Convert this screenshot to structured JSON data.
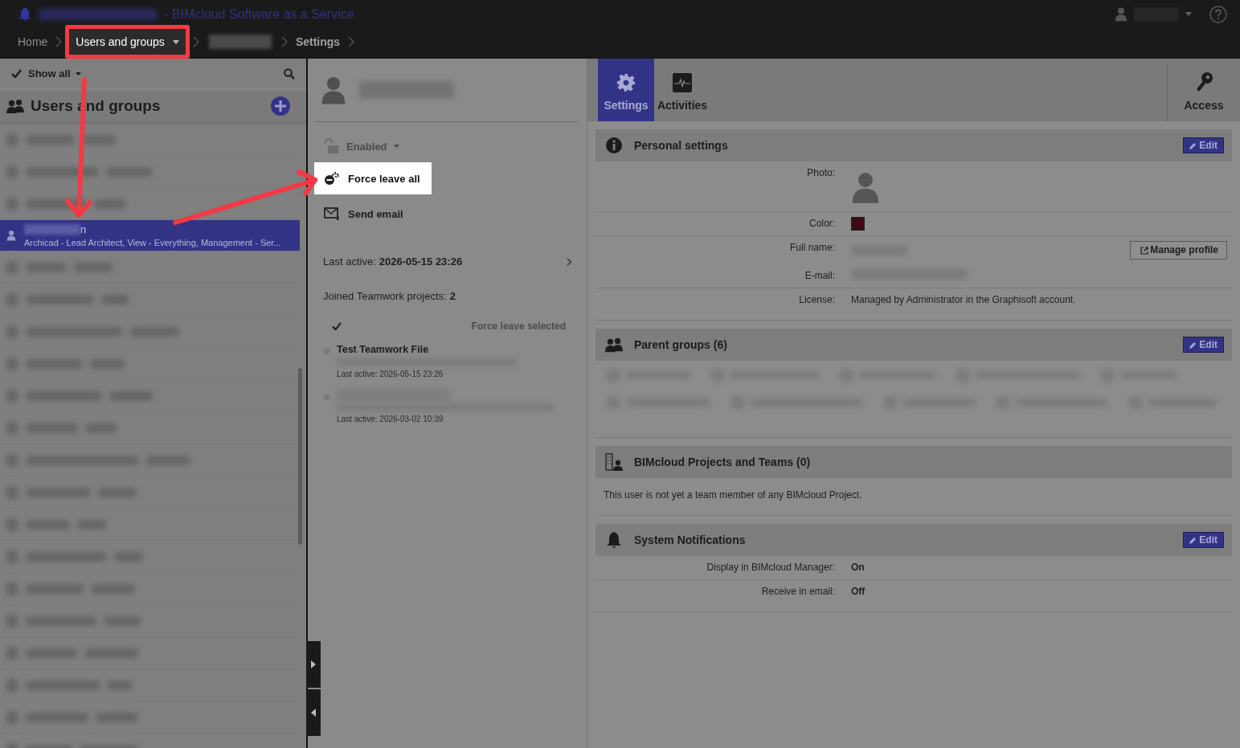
{
  "window": {
    "title": "- BIMcloud Software as a Service"
  },
  "breadcrumb": [
    {
      "kind": "link",
      "label": "Home"
    },
    {
      "kind": "dropdown",
      "label": "Users and groups",
      "highlighted": true
    },
    {
      "kind": "redacted"
    },
    {
      "kind": "current",
      "label": "Settings"
    }
  ],
  "left_panel": {
    "filter": "Show all",
    "title": "Users and groups",
    "items": [
      {
        "kind": "redacted",
        "selected": false
      },
      {
        "kind": "redacted",
        "selected": false
      },
      {
        "kind": "redacted",
        "selected": false
      },
      {
        "kind": "user",
        "selected": true,
        "name_tail": "n",
        "subtitle": "Archicad - Lead Architect, View - Everything, Management - Ser..."
      },
      {
        "kind": "redacted",
        "selected": false
      },
      {
        "kind": "redacted",
        "selected": false
      },
      {
        "kind": "redacted",
        "selected": false
      },
      {
        "kind": "redacted",
        "selected": false
      },
      {
        "kind": "redacted",
        "selected": false
      },
      {
        "kind": "redacted",
        "selected": false
      },
      {
        "kind": "redacted",
        "selected": false
      },
      {
        "kind": "redacted",
        "selected": false
      },
      {
        "kind": "redacted",
        "selected": false
      },
      {
        "kind": "redacted",
        "selected": false
      },
      {
        "kind": "redacted",
        "selected": false
      },
      {
        "kind": "redacted",
        "selected": false
      },
      {
        "kind": "redacted",
        "selected": false
      },
      {
        "kind": "redacted",
        "selected": false
      },
      {
        "kind": "redacted",
        "selected": false
      },
      {
        "kind": "redacted",
        "selected": false
      }
    ]
  },
  "user_panel": {
    "status": "Enabled",
    "actions": [
      {
        "kind": "force_leave",
        "label": "Force leave all",
        "highlighted": true
      },
      {
        "kind": "email",
        "label": "Send email",
        "highlighted": false
      }
    ],
    "last_active_label": "Last active:",
    "last_active": "2026-05-15 23:26",
    "joined_label": "Joined Teamwork projects:",
    "joined_count": "2",
    "force_leave_selected": {
      "label": "Force leave selected",
      "disabled": true
    },
    "projects": [
      {
        "name": "Test Teamwork File",
        "last_active": "Last active: 2026-05-15 23:26"
      },
      {
        "last_active": "Last active: 2026-03-02 10:39"
      }
    ]
  },
  "tabs": [
    {
      "kind": "settings",
      "label": "Settings",
      "selected": true
    },
    {
      "kind": "activities",
      "label": "Activities",
      "selected": false
    }
  ],
  "access": {
    "label": "Access"
  },
  "sections": [
    {
      "kind": "fields",
      "title": "Personal settings",
      "edit": "Edit",
      "rows": [
        {
          "kind": "photo",
          "label": "Photo:"
        },
        {
          "kind": "color",
          "label": "Color:",
          "color": "#3d0a17"
        },
        {
          "kind": "redacted",
          "label": "Full name:",
          "button": "Manage profile"
        },
        {
          "kind": "redacted",
          "label": "E-mail:"
        },
        {
          "kind": "text",
          "label": "License:",
          "value": "Managed by Administrator in the Graphisoft account."
        }
      ]
    },
    {
      "kind": "chips",
      "title": "Parent groups (6)",
      "edit": "Edit"
    },
    {
      "kind": "message",
      "title": "BIMcloud Projects and Teams (0)",
      "message": "This user is not yet a team member of any BIMcloud Project."
    },
    {
      "kind": "fields",
      "title": "System Notifications",
      "edit": "Edit",
      "rows": [
        {
          "kind": "bold",
          "label": "Display in BIMcloud Manager:",
          "value": "On"
        },
        {
          "kind": "bold",
          "label": "Receive in email:",
          "value": "Off"
        }
      ]
    }
  ]
}
